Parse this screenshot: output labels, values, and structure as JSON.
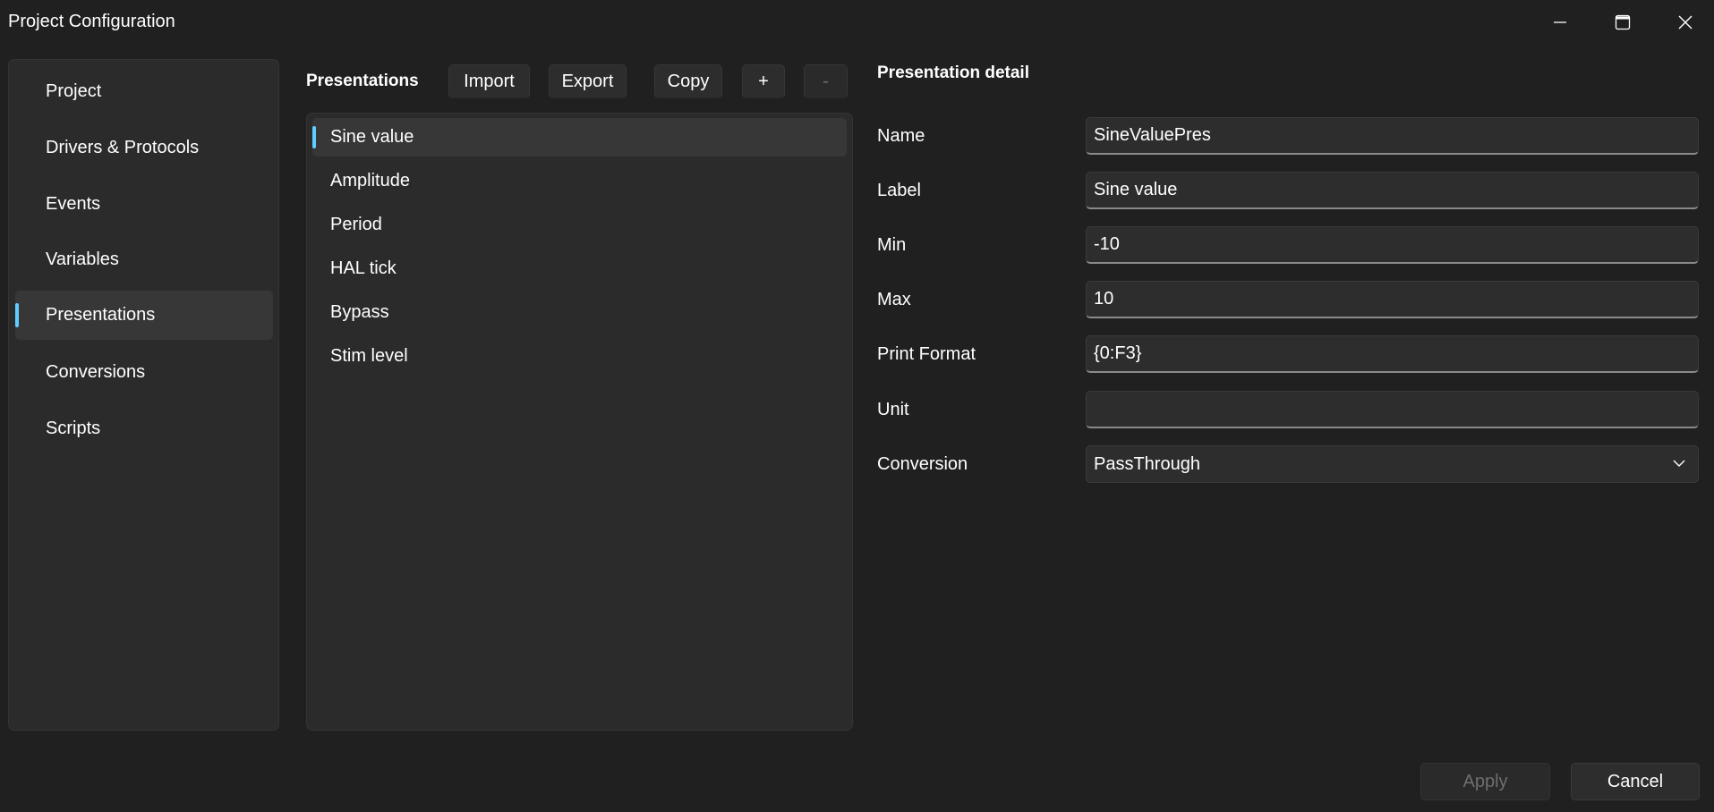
{
  "window": {
    "title": "Project Configuration",
    "controls": [
      "minimize-icon",
      "maximize-icon",
      "close-icon"
    ]
  },
  "sidebar": {
    "items": [
      {
        "label": "Project",
        "selected": false
      },
      {
        "label": "Drivers & Protocols",
        "selected": false
      },
      {
        "label": "Events",
        "selected": false
      },
      {
        "label": "Variables",
        "selected": false
      },
      {
        "label": "Presentations",
        "selected": true
      },
      {
        "label": "Conversions",
        "selected": false
      },
      {
        "label": "Scripts",
        "selected": false
      }
    ]
  },
  "presentations": {
    "title": "Presentations",
    "toolbar": {
      "import_label": "Import",
      "export_label": "Export",
      "copy_label": "Copy",
      "add_label": "+",
      "remove_label": "-"
    },
    "items": [
      {
        "label": "Sine value",
        "selected": true
      },
      {
        "label": "Amplitude",
        "selected": false
      },
      {
        "label": "Period",
        "selected": false
      },
      {
        "label": "HAL tick",
        "selected": false
      },
      {
        "label": "Bypass",
        "selected": false
      },
      {
        "label": "Stim level",
        "selected": false
      }
    ]
  },
  "detail": {
    "title": "Presentation detail",
    "fields": {
      "name": {
        "label": "Name",
        "value": "SineValuePres"
      },
      "label": {
        "label": "Label",
        "value": "Sine value"
      },
      "min": {
        "label": "Min",
        "value": "-10"
      },
      "max": {
        "label": "Max",
        "value": "10"
      },
      "print_format": {
        "label": "Print Format",
        "value": "{0:F3}"
      },
      "unit": {
        "label": "Unit",
        "value": ""
      },
      "conversion": {
        "label": "Conversion",
        "value": "PassThrough"
      }
    }
  },
  "footer": {
    "apply_label": "Apply",
    "cancel_label": "Cancel"
  },
  "colors": {
    "accent": "#60cdff",
    "background": "#202020",
    "panel": "#2b2b2b"
  }
}
